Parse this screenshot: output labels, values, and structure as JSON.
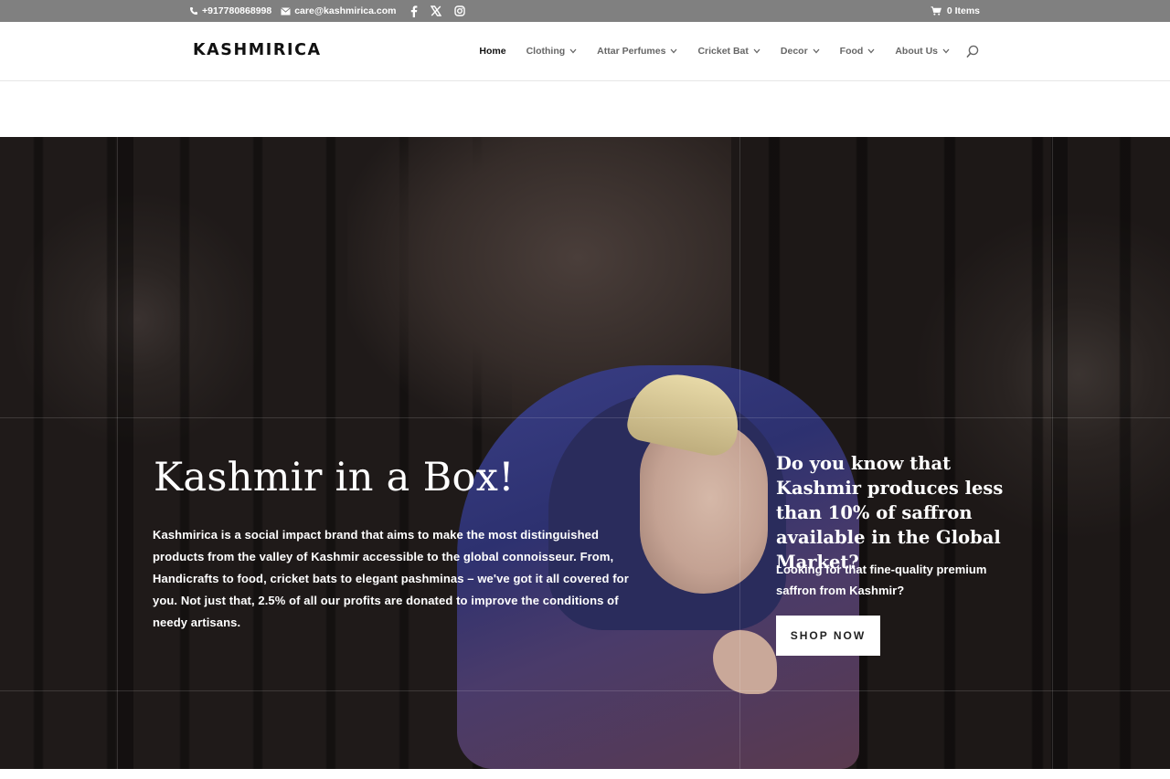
{
  "topbar": {
    "phone": "+917780868998",
    "email": "care@kashmirica.com",
    "cart": "0 Items",
    "social_icons": [
      "facebook-icon",
      "x-twitter-icon",
      "instagram-icon"
    ]
  },
  "header": {
    "logo": "KASHMIRICA",
    "nav": [
      {
        "label": "Home",
        "active": true,
        "has_dropdown": false
      },
      {
        "label": "Clothing",
        "has_dropdown": true
      },
      {
        "label": "Attar Perfumes",
        "has_dropdown": true
      },
      {
        "label": "Cricket Bat",
        "has_dropdown": true
      },
      {
        "label": "Decor",
        "has_dropdown": true
      },
      {
        "label": "Food",
        "has_dropdown": true
      },
      {
        "label": "About Us",
        "has_dropdown": true
      }
    ]
  },
  "hero": {
    "title": "Kashmir in a Box!",
    "body": "Kashmirica is a social impact brand that aims to make the most distinguished products from the valley of Kashmir accessible to the global connoisseur. From, Handicrafts to food, cricket bats to elegant pashminas – we've got it all covered for you. Not just that, 2.5% of all our profits are donated to improve the conditions of needy artisans.",
    "side_title": "Do you know that Kashmir produces less than 10% of saffron available in the Global Market?",
    "side_body": "Looking for that fine-quality premium saffron from Kashmir?",
    "cta": "SHOP NOW"
  },
  "colors": {
    "topbar_bg": "#808080",
    "hero_bg": "#241d1b",
    "button_bg": "#ffffff"
  }
}
